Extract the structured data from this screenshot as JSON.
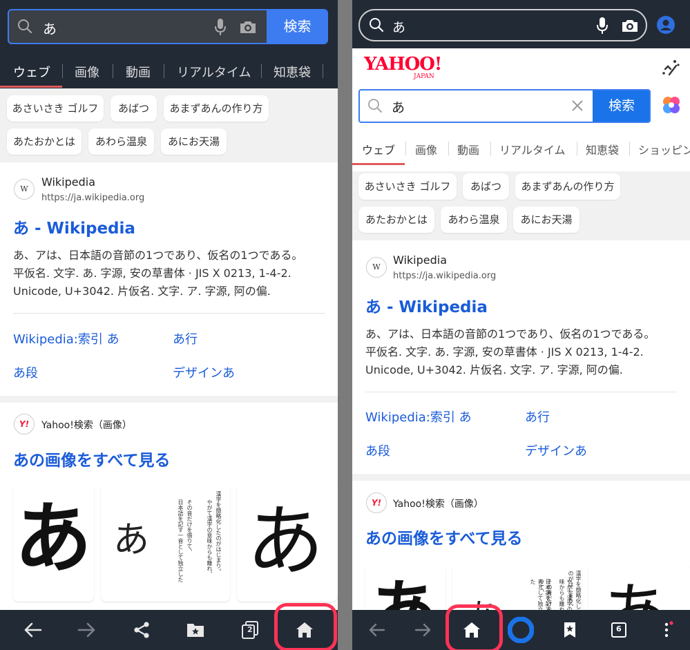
{
  "search": {
    "query": "あ",
    "button": "検索"
  },
  "tabs": [
    "ウェブ",
    "画像",
    "動画",
    "リアルタイム",
    "知恵袋",
    "ショッピング"
  ],
  "tabs_short": [
    "ウェブ",
    "画像",
    "動画",
    "リアルタイム",
    "知恵袋"
  ],
  "tab_last_right": "ショッピン",
  "suggestions": [
    "あさいさき ゴルフ",
    "あばつ",
    "あまずあんの作り方",
    "あたおかとは",
    "あわら温泉",
    "あにお天湯"
  ],
  "result1": {
    "source_icon": "W",
    "source_name": "Wikipedia",
    "source_url": "https://ja.wikipedia.org",
    "title": "あ - Wikipedia",
    "snippet_lines": [
      "あ、アは、日本語の音節の1つであり、仮名の1つである。",
      "平仮名. 文字. あ. 字源, 安の草書体 · JIS X 0213, 1-4-2.",
      "Unicode, U+3042. 片仮名. 文字. ア. 字源, 阿の偏."
    ],
    "links": [
      "Wikipedia:索引 あ",
      "あ行",
      "あ段",
      "デザインあ"
    ]
  },
  "result2": {
    "source_icon": "Y!",
    "source_name": "Yahoo!検索（画像）",
    "title": "あの画像をすべて見る",
    "glyph": "あ",
    "book_text": [
      "漢字を簡略化したのがはじまり。",
      "やがて漢字の意味からも離れ、",
      "その音だけを借りて、",
      "日本語を記す一音として独立した"
    ]
  },
  "logo": {
    "main": "YAHOO!",
    "sub": "JAPAN"
  },
  "tab_count": "2",
  "tab_count_right": "6",
  "colors": {
    "bar": "#222a36",
    "accent": "#1a73e8",
    "link": "#1a5cd8",
    "highlight": "#ff3355",
    "tab_underline": "#e05a5a"
  }
}
